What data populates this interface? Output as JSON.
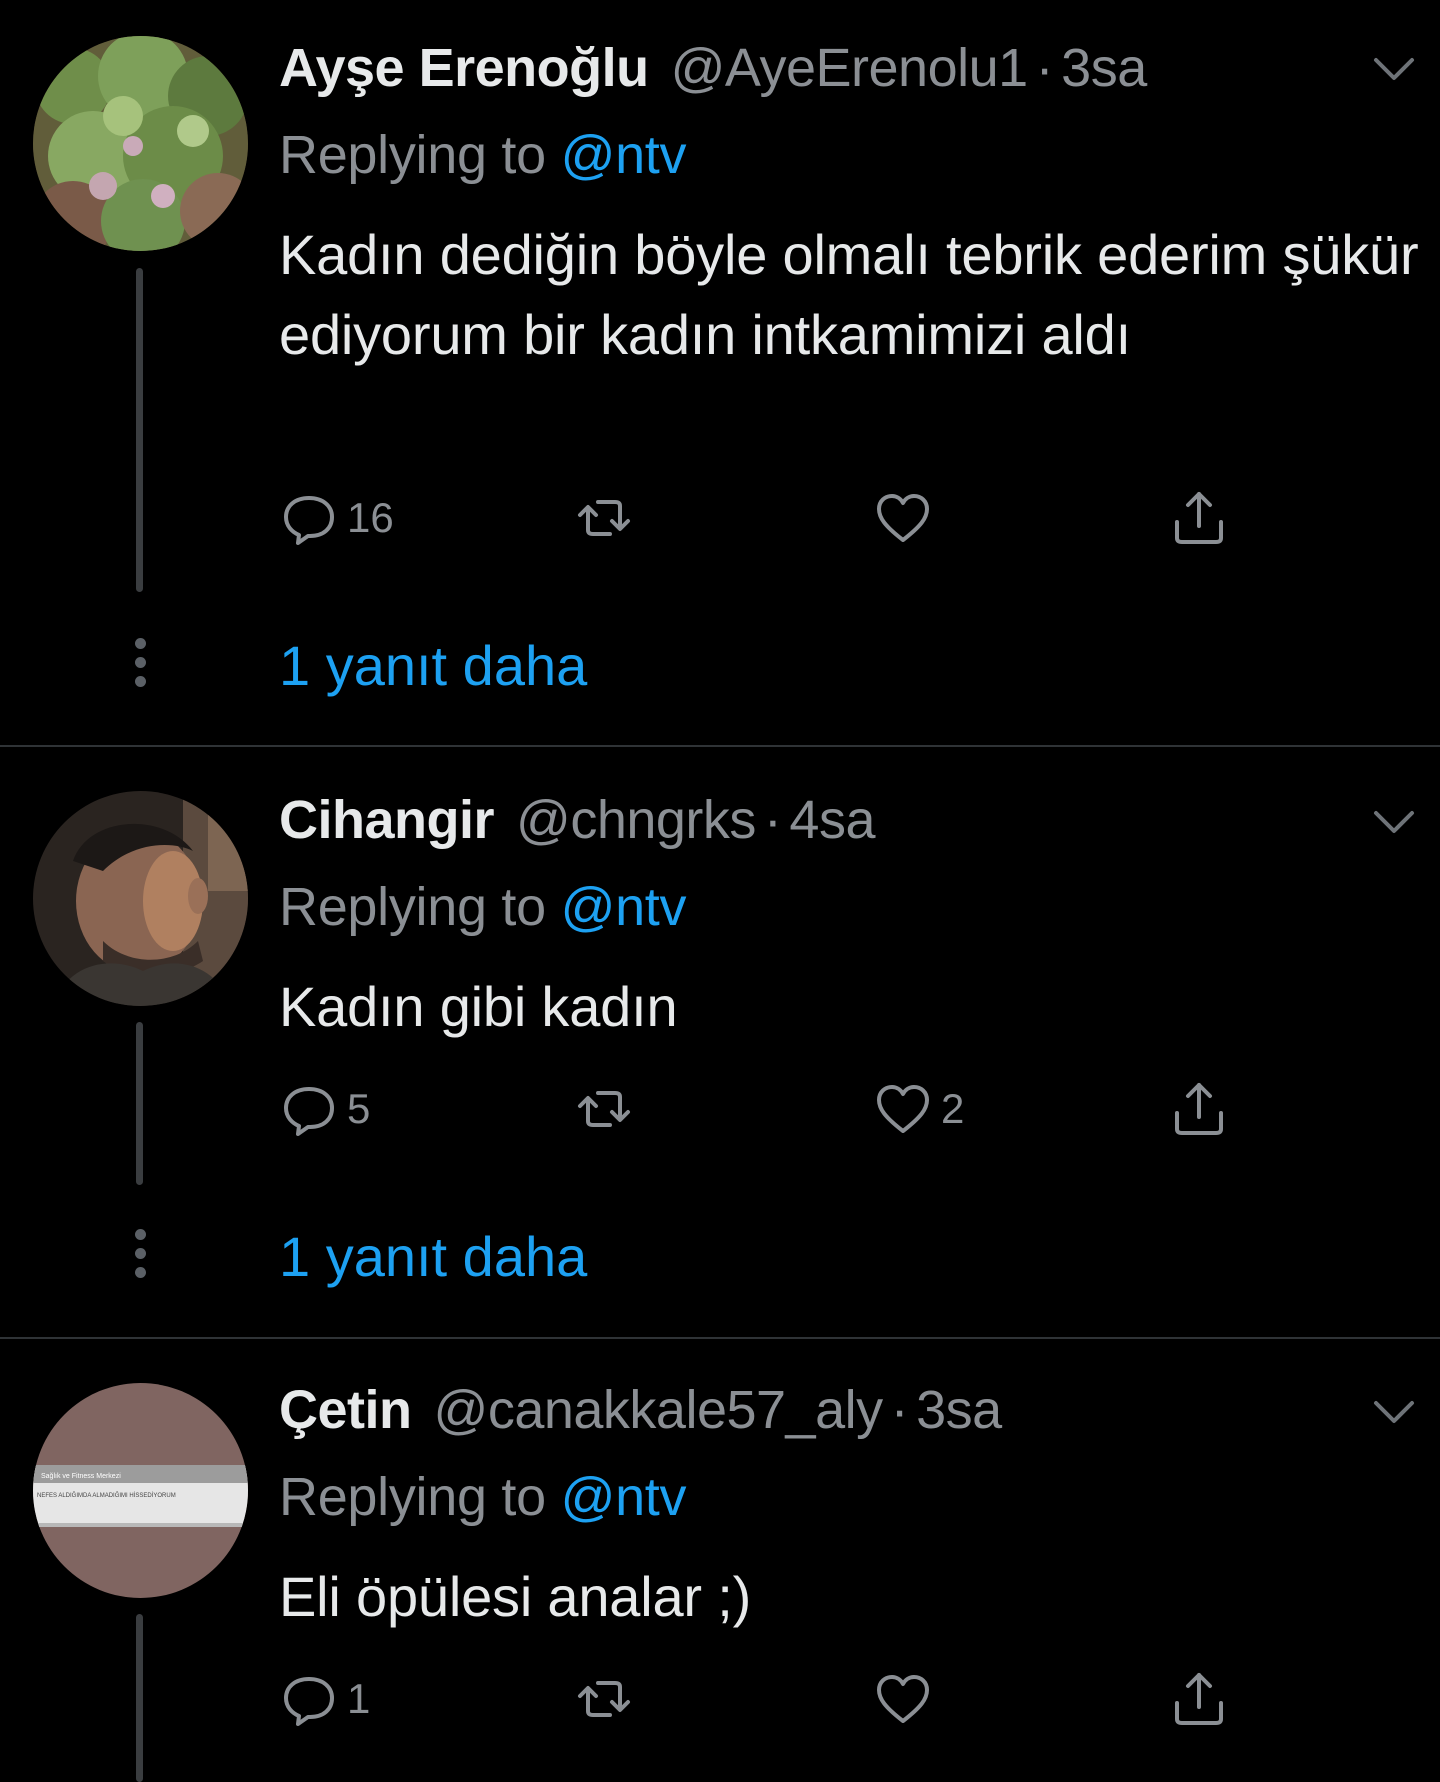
{
  "tweets": [
    {
      "name": "Ayşe Erenoğlu",
      "handle": "@AyeErenolu1",
      "time": "3sa",
      "replying_prefix": "Replying to",
      "replying_mention": "@ntv",
      "text": "Kadın dediğin böyle olmalı tebrik ederim şükür ediyorum bir kadın intkamimizi aldı",
      "reply_count": "16",
      "retweet_count": "",
      "like_count": "",
      "more_replies": "1 yanıt daha"
    },
    {
      "name": "Cihangir",
      "handle": "@chngrks",
      "time": "4sa",
      "replying_prefix": "Replying to",
      "replying_mention": "@ntv",
      "text": "Kadın gibi kadın",
      "reply_count": "5",
      "retweet_count": "",
      "like_count": "2",
      "more_replies": "1 yanıt daha"
    },
    {
      "name": "Çetin",
      "handle": "@canakkale57_aly",
      "time": "3sa",
      "replying_prefix": "Replying to",
      "replying_mention": "@ntv",
      "text": "Eli öpülesi analar ;)",
      "reply_count": "1",
      "retweet_count": "",
      "like_count": ""
    }
  ],
  "avatar3_sign": {
    "line1": "Sağlık ve Fitness Merkezi",
    "line2": "NEFES ALDIĞIMDA ALMADIĞIMI HİSSEDİYORUM"
  },
  "separator": "·",
  "colors": {
    "background": "#000000",
    "primary_text": "#e7e9ea",
    "secondary_text": "#8b8f94",
    "accent": "#1da1f2",
    "divider": "#2f3336"
  },
  "icons": [
    "reply-icon",
    "retweet-icon",
    "like-icon",
    "share-icon",
    "chevron-down-icon",
    "thread-more-icon"
  ]
}
